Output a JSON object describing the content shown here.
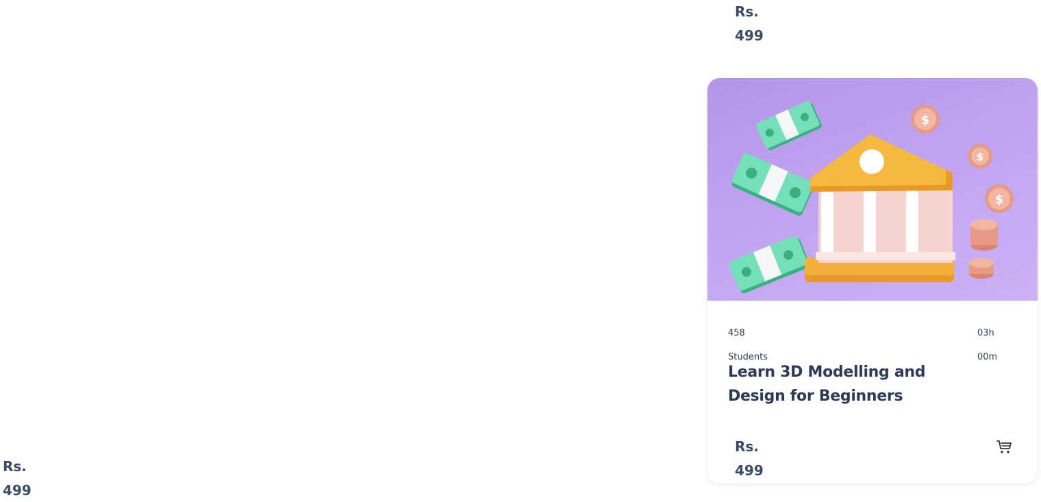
{
  "top_price": {
    "currency": "Rs.",
    "amount": "499"
  },
  "left_price": {
    "currency": "Rs.",
    "amount": "499"
  },
  "course_card": {
    "image_icon": "bank-with-money-illustration",
    "students_count": "458",
    "students_label": "Students",
    "duration_hours": "03h",
    "duration_minutes": "00m",
    "title": "Learn 3D Modelling and Design for Beginners",
    "price_currency": "Rs.",
    "price_amount": "499",
    "cart_icon": "cart-icon"
  },
  "colors": {
    "image_background": "#c3a6f2",
    "text_primary": "#2c3a57",
    "price_text": "#3a4b66"
  }
}
